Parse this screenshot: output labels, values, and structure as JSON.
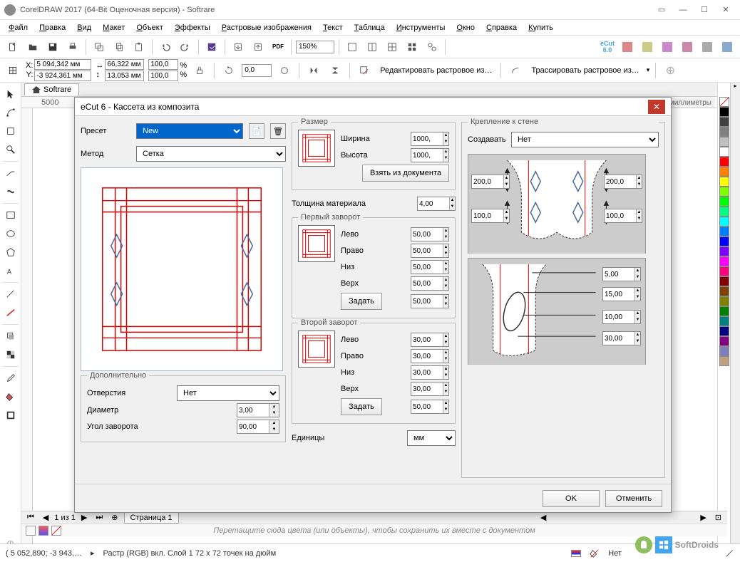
{
  "app": {
    "title": "CorelDRAW 2017 (64-Bit Оценочная версия) - Softrare",
    "doc_tab": "Softrare",
    "units_label": "миллиметры"
  },
  "menu": [
    "Файл",
    "Правка",
    "Вид",
    "Макет",
    "Объект",
    "Эффекты",
    "Растровые изображения",
    "Текст",
    "Таблица",
    "Инструменты",
    "Окно",
    "Справка",
    "Купить"
  ],
  "toolbar": {
    "zoom": "150%"
  },
  "propbar": {
    "x": "5 094,342 мм",
    "y": "-3 924,361 мм",
    "w": "66,322 мм",
    "h": "13,053 мм",
    "sx": "100,0",
    "sy": "100,0",
    "spct": "%",
    "rot": "0,0",
    "edit_bitmap": "Редактировать растровое из…",
    "trace_bitmap": "Трассировать растровое из…"
  },
  "ruler_mark": "5000",
  "page": {
    "nav_text": "1 из 1",
    "tab": "Страница 1"
  },
  "dock": {
    "hint": "Перетащите сюда цвета (или объекты), чтобы сохранить их вместе с документом"
  },
  "status": {
    "coords": "( 5 052,890; -3 943,…",
    "layer": "Растр (RGB) вкл. Слой 1 72 x 72 точек на дюйм",
    "fill": "Нет"
  },
  "dialog": {
    "title": "eCut 6 - Кассета из композита",
    "preset_label": "Пресет",
    "preset_value": "New",
    "method_label": "Метод",
    "method_value": "Сетка",
    "extra_title": "Дополнительно",
    "holes_label": "Отверстия",
    "holes_value": "Нет",
    "diam_label": "Диаметр",
    "diam_value": "3,00",
    "angle_label": "Угол заворота",
    "angle_value": "90,00",
    "size_title": "Размер",
    "width_label": "Ширина",
    "width_value": "1000,",
    "height_label": "Высота",
    "height_value": "1000,",
    "take_from_doc": "Взять из документа",
    "thickness_label": "Толщина материала",
    "thickness_value": "4,00",
    "fold1_title": "Первый заворот",
    "fold2_title": "Второй заворот",
    "left_label": "Лево",
    "right_label": "Право",
    "bottom_label": "Низ",
    "top_label": "Верх",
    "set_btn": "Задать",
    "f1_left": "50,00",
    "f1_right": "50,00",
    "f1_bottom": "50,00",
    "f1_top": "50,00",
    "f1_set": "50,00",
    "f2_left": "30,00",
    "f2_right": "30,00",
    "f2_bottom": "30,00",
    "f2_top": "30,00",
    "f2_set": "50,00",
    "units_label": "Единицы",
    "units_value": "мм",
    "wall_title": "Крепление к стене",
    "create_label": "Создавать",
    "create_value": "Нет",
    "wall_a": "200,0",
    "wall_b": "200,0",
    "wall_c": "100,0",
    "wall_d": "100,0",
    "wall_e": "5,00",
    "wall_f": "15,00",
    "wall_g": "10,00",
    "wall_h": "30,00",
    "ok": "OK",
    "cancel": "Отменить"
  },
  "colors": [
    "#000000",
    "#404040",
    "#808080",
    "#c0c0c0",
    "#ffffff",
    "#ff0000",
    "#ff8000",
    "#ffff00",
    "#80ff00",
    "#00ff00",
    "#00ff80",
    "#00ffff",
    "#0080ff",
    "#0000ff",
    "#8000ff",
    "#ff00ff",
    "#ff0080",
    "#800000",
    "#804000",
    "#808000",
    "#008000",
    "#008080",
    "#000080",
    "#800080",
    "#8080c0",
    "#c0a080"
  ],
  "watermark": "SoftDroids"
}
